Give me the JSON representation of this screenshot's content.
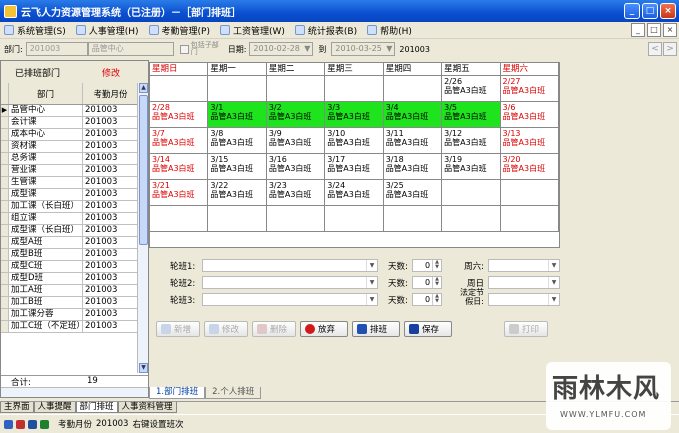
{
  "title": "云飞人力资源管理系统（已注册）－［部门排班］",
  "menus": [
    {
      "label": "系统管理(S)"
    },
    {
      "label": "人事管理(H)"
    },
    {
      "label": "考勤管理(P)"
    },
    {
      "label": "工资管理(W)"
    },
    {
      "label": "统计报表(B)"
    },
    {
      "label": "帮助(H)"
    }
  ],
  "filter": {
    "dept_label": "部门:",
    "dept_code": "201003",
    "dept_name": "品管中心",
    "chk1": "包括子部",
    "chk2": "门",
    "date_label": "日期:",
    "date_from": "2010-02-28",
    "to_label": "到",
    "date_to": "2010-03-25",
    "month": "201003"
  },
  "left": {
    "header": "已排班部门",
    "modify": "修改",
    "col_dept": "部门",
    "col_month": "考勤月份",
    "rows": [
      [
        "品管中心",
        "201003"
      ],
      [
        "会计课",
        "201003"
      ],
      [
        "成本中心",
        "201003"
      ],
      [
        "资材课",
        "201003"
      ],
      [
        "总务课",
        "201003"
      ],
      [
        "营业课",
        "201003"
      ],
      [
        "生管课",
        "201003"
      ],
      [
        "成型课",
        "201003"
      ],
      [
        "加工课（长白班）",
        "201003"
      ],
      [
        "组立课",
        "201003"
      ],
      [
        "成型课（长白班）",
        "201003"
      ],
      [
        "成型A班",
        "201003"
      ],
      [
        "成型B班",
        "201003"
      ],
      [
        "成型C班",
        "201003"
      ],
      [
        "成型D班",
        "201003"
      ],
      [
        "加工A班",
        "201003"
      ],
      [
        "加工B班",
        "201003"
      ],
      [
        "加工课分蓉",
        "201003"
      ],
      [
        "加工C班（不定班）",
        "201003"
      ]
    ],
    "total_label": "合计:",
    "total": "19"
  },
  "calendar": {
    "days": [
      "星期日",
      "星期一",
      "星期二",
      "星期三",
      "星期四",
      "星期五",
      "星期六"
    ],
    "weeks": [
      [
        {
          "d": "",
          "s": "",
          "t": ""
        },
        {
          "d": "",
          "s": "",
          "t": ""
        },
        {
          "d": "",
          "s": "",
          "t": ""
        },
        {
          "d": "",
          "s": "",
          "t": ""
        },
        {
          "d": "",
          "s": "",
          "t": ""
        },
        {
          "d": "2/26",
          "s": "品管A3白班",
          "t": "n"
        },
        {
          "d": "2/27",
          "s": "品管A3白班",
          "t": "r"
        }
      ],
      [
        {
          "d": "2/28",
          "s": "品管A3白班",
          "t": "r"
        },
        {
          "d": "3/1",
          "s": "品管A3白班",
          "t": "g"
        },
        {
          "d": "3/2",
          "s": "品管A3白班",
          "t": "g"
        },
        {
          "d": "3/3",
          "s": "品管A3白班",
          "t": "g"
        },
        {
          "d": "3/4",
          "s": "品管A3白班",
          "t": "g"
        },
        {
          "d": "3/5",
          "s": "品管A3白班",
          "t": "g"
        },
        {
          "d": "3/6",
          "s": "品管A3白班",
          "t": "r"
        }
      ],
      [
        {
          "d": "3/7",
          "s": "品管A3白班",
          "t": "r"
        },
        {
          "d": "3/8",
          "s": "品管A3白班",
          "t": "n"
        },
        {
          "d": "3/9",
          "s": "品管A3白班",
          "t": "n"
        },
        {
          "d": "3/10",
          "s": "品管A3白班",
          "t": "n"
        },
        {
          "d": "3/11",
          "s": "品管A3白班",
          "t": "n"
        },
        {
          "d": "3/12",
          "s": "品管A3白班",
          "t": "n"
        },
        {
          "d": "3/13",
          "s": "品管A3白班",
          "t": "r"
        }
      ],
      [
        {
          "d": "3/14",
          "s": "品管A3白班",
          "t": "r"
        },
        {
          "d": "3/15",
          "s": "品管A3白班",
          "t": "n"
        },
        {
          "d": "3/16",
          "s": "品管A3白班",
          "t": "n"
        },
        {
          "d": "3/17",
          "s": "品管A3白班",
          "t": "n"
        },
        {
          "d": "3/18",
          "s": "品管A3白班",
          "t": "n"
        },
        {
          "d": "3/19",
          "s": "品管A3白班",
          "t": "n"
        },
        {
          "d": "3/20",
          "s": "品管A3白班",
          "t": "r"
        }
      ],
      [
        {
          "d": "3/21",
          "s": "品管A3白班",
          "t": "r"
        },
        {
          "d": "3/22",
          "s": "品管A3白班",
          "t": "n"
        },
        {
          "d": "3/23",
          "s": "品管A3白班",
          "t": "n"
        },
        {
          "d": "3/24",
          "s": "品管A3白班",
          "t": "n"
        },
        {
          "d": "3/25",
          "s": "品管A3白班",
          "t": "n"
        },
        {
          "d": "",
          "s": "",
          "t": ""
        },
        {
          "d": "",
          "s": "",
          "t": ""
        }
      ],
      [
        {
          "d": "",
          "s": "",
          "t": ""
        },
        {
          "d": "",
          "s": "",
          "t": ""
        },
        {
          "d": "",
          "s": "",
          "t": ""
        },
        {
          "d": "",
          "s": "",
          "t": ""
        },
        {
          "d": "",
          "s": "",
          "t": ""
        },
        {
          "d": "",
          "s": "",
          "t": ""
        },
        {
          "d": "",
          "s": "",
          "t": ""
        }
      ]
    ]
  },
  "form": {
    "shift1": "轮班1:",
    "shift2": "轮班2:",
    "shift3": "轮班3:",
    "days": "天数:",
    "days_val": "0",
    "sat": "周六:",
    "sun": "周日",
    "holiday": "法定节",
    "holiday2": "假日:"
  },
  "buttons": {
    "add": "新增",
    "edit": "修改",
    "del": "删除",
    "cancel": "放弃",
    "schedule": "排班",
    "save": "保存",
    "print": "打印"
  },
  "tabs": {
    "t1": "1.部门排班",
    "t2": "2.个人排班"
  },
  "bottom_tabs": [
    "主界面",
    "人事提醒",
    "部门排班",
    "人事资料管理"
  ],
  "status": {
    "label": "考勤月份",
    "month": "201003",
    "hint": "右键设置班次"
  },
  "watermark": {
    "main": "雨林木风",
    "url": "WWW.YLMFU.COM"
  }
}
